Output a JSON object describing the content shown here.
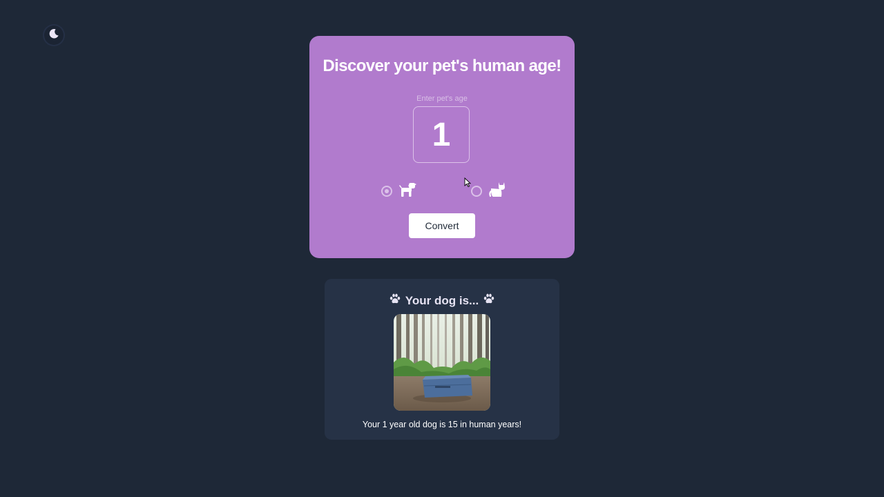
{
  "theme_toggle": {
    "icon": "moon-icon"
  },
  "card": {
    "title": "Discover your pet's human age!",
    "age_label": "Enter pet's age",
    "age_value": "1",
    "options": [
      {
        "icon": "dog-icon",
        "selected": true
      },
      {
        "icon": "cat-icon",
        "selected": false
      }
    ],
    "convert_label": "Convert"
  },
  "result": {
    "heading": "Your dog is...",
    "image": "suitcase-in-forest-image",
    "text": "Your 1 year old dog is 15 in human years!"
  },
  "colors": {
    "background": "#1e2837",
    "card": "#b17bcd",
    "result_card": "#263246",
    "button": "#ffffff"
  }
}
